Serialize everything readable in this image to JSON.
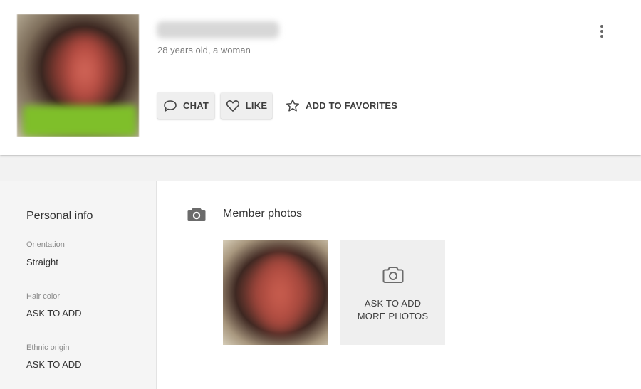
{
  "profile": {
    "subtitle": "28 years old, a woman",
    "actions": {
      "chat_label": "CHAT",
      "like_label": "LIKE",
      "favorites_label": "ADD TO FAVORITES"
    }
  },
  "sidebar": {
    "title": "Personal info",
    "fields": [
      {
        "label": "Orientation",
        "value": "Straight"
      },
      {
        "label": "Hair color",
        "value": "ASK TO ADD"
      },
      {
        "label": "Ethnic origin",
        "value": "ASK TO ADD"
      }
    ]
  },
  "photos": {
    "title": "Member photos",
    "ask_label": "ASK TO ADD MORE PHOTOS"
  },
  "icons": {
    "header": "more-vertical-icon",
    "chat": "chat-bubble-icon",
    "like": "heart-icon",
    "favorites": "star-icon",
    "section": "camera-icon"
  },
  "colors": {
    "header_bg": "#ffffff",
    "page_bg": "#f2f2f2",
    "sidebar_bg": "#f5f5f5",
    "button_bg": "#efefef",
    "text_primary": "#333333",
    "text_muted": "#7a7a7a"
  }
}
